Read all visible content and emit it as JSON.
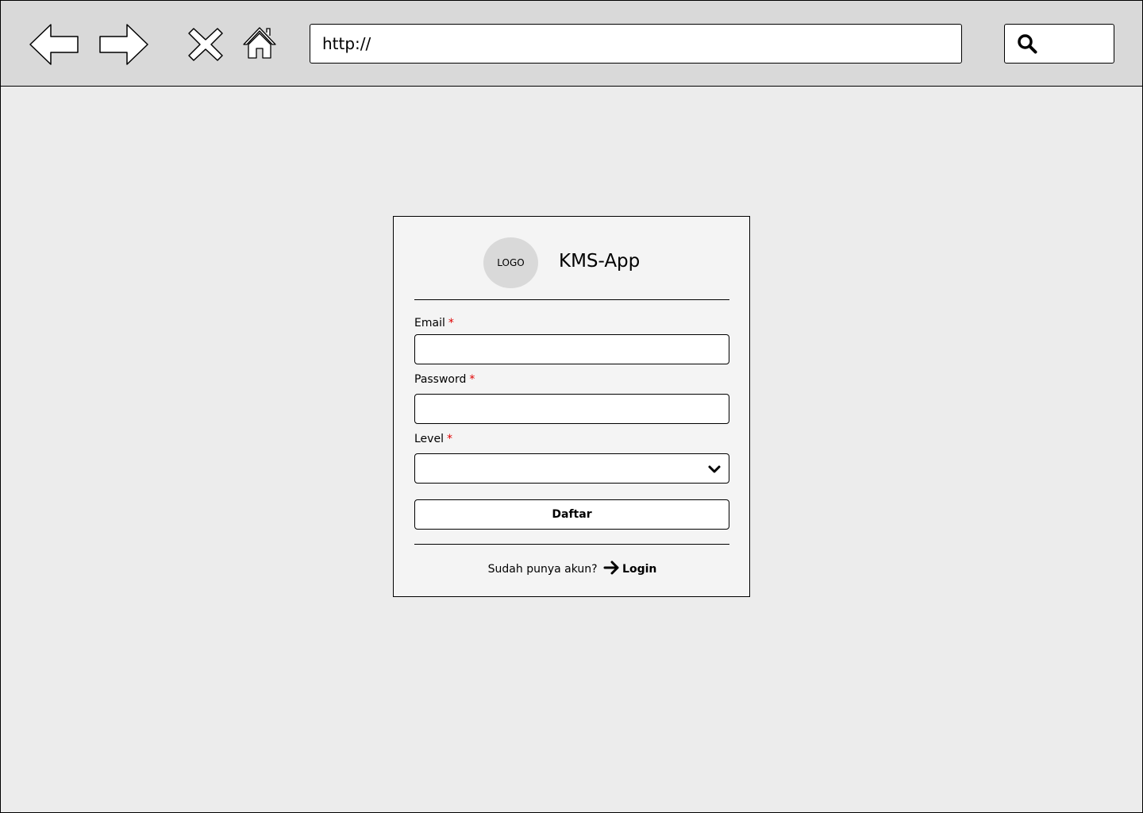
{
  "browser": {
    "url": "http://",
    "icons": [
      "back-arrow-icon",
      "forward-arrow-icon",
      "close-icon",
      "home-icon",
      "search-icon"
    ]
  },
  "card": {
    "logo_text": "LOGO",
    "app_name": "KMS-App",
    "fields": {
      "email_label": "Email",
      "password_label": "Password",
      "level_label": "Level",
      "required_marker": "*"
    },
    "submit_label": "Daftar",
    "footer_text": "Sudah punya akun?",
    "login_label": "Login"
  },
  "colors": {
    "required": "#e00000",
    "toolbar_bg": "#d9d9d9",
    "page_bg": "#ececec",
    "card_bg": "#f4f4f4"
  }
}
